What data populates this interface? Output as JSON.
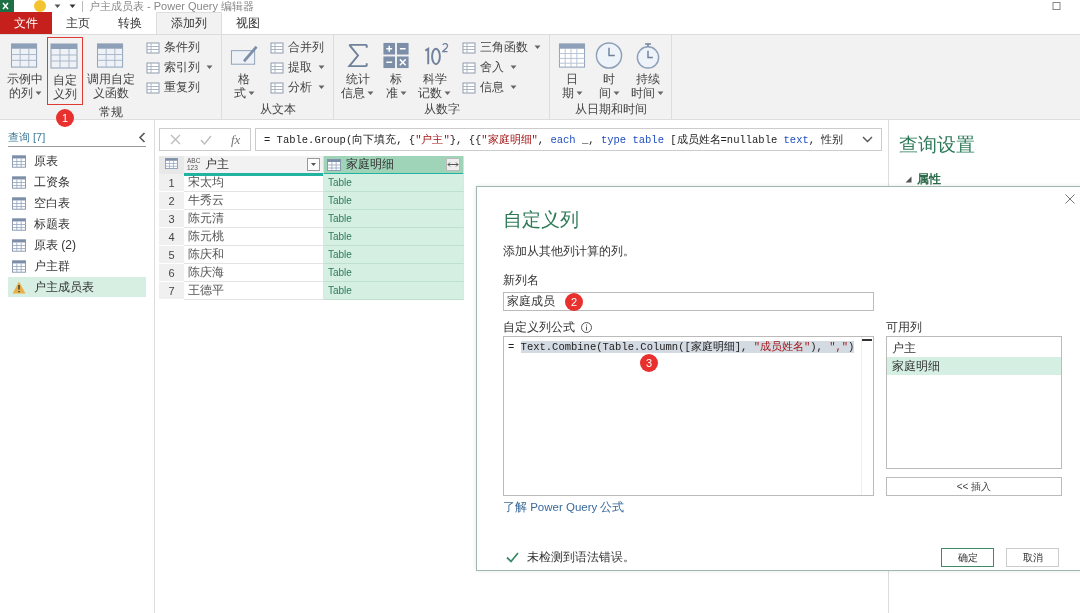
{
  "window": {
    "title": "户主成员表 - Power Query 编辑器"
  },
  "menu_tabs": [
    {
      "label": "文件",
      "kind": "file",
      "selected": false
    },
    {
      "label": "主页",
      "kind": "tab",
      "selected": false
    },
    {
      "label": "转换",
      "kind": "tab",
      "selected": false
    },
    {
      "label": "添加列",
      "kind": "tab",
      "selected": true
    },
    {
      "label": "视图",
      "kind": "tab",
      "selected": false
    }
  ],
  "ribbon": {
    "groups": [
      {
        "name": "常规",
        "items": [
          {
            "kind": "large",
            "label_lines": [
              "示例中",
              "的列"
            ],
            "dropdown": true,
            "highlighted": false
          },
          {
            "kind": "large",
            "label_lines": [
              "自定",
              "义列"
            ],
            "dropdown": false,
            "highlighted": true,
            "badge": "1"
          },
          {
            "kind": "large",
            "label_lines": [
              "调用自定",
              "义函数"
            ],
            "dropdown": false,
            "highlighted": false
          },
          {
            "kind": "small",
            "label": "条件列",
            "dropdown": false
          },
          {
            "kind": "small",
            "label": "索引列",
            "dropdown": true
          },
          {
            "kind": "small",
            "label": "重复列",
            "dropdown": false
          }
        ]
      },
      {
        "name": "从文本",
        "items": [
          {
            "kind": "large",
            "label_lines": [
              "格",
              "式"
            ],
            "dropdown": true,
            "highlighted": false
          },
          {
            "kind": "small",
            "label": "合并列",
            "dropdown": false
          },
          {
            "kind": "small",
            "label": "提取",
            "dropdown": true
          },
          {
            "kind": "small",
            "label": "分析",
            "dropdown": true
          }
        ]
      },
      {
        "name": "从数字",
        "items": [
          {
            "kind": "large",
            "label_lines": [
              "统计",
              "信息"
            ],
            "dropdown": true,
            "highlighted": false
          },
          {
            "kind": "large",
            "label_lines": [
              "标",
              "准"
            ],
            "dropdown": true,
            "highlighted": false
          },
          {
            "kind": "large",
            "label_lines": [
              "科学",
              "记数"
            ],
            "dropdown": true,
            "highlighted": false
          },
          {
            "kind": "small",
            "label": "三角函数",
            "dropdown": true
          },
          {
            "kind": "small",
            "label": "舍入",
            "dropdown": true
          },
          {
            "kind": "small",
            "label": "信息",
            "dropdown": true
          }
        ]
      },
      {
        "name": "从日期和时间",
        "items": [
          {
            "kind": "large",
            "label_lines": [
              "日",
              "期"
            ],
            "dropdown": true,
            "highlighted": false
          },
          {
            "kind": "large",
            "label_lines": [
              "时",
              "间"
            ],
            "dropdown": true,
            "highlighted": false
          },
          {
            "kind": "large",
            "label_lines": [
              "持续",
              "时间"
            ],
            "dropdown": true,
            "highlighted": false
          }
        ]
      }
    ]
  },
  "queries": {
    "header": "查询 [7]",
    "items": [
      {
        "label": "原表",
        "kind": "table",
        "selected": false
      },
      {
        "label": "工资条",
        "kind": "table",
        "selected": false
      },
      {
        "label": "空白表",
        "kind": "table",
        "selected": false
      },
      {
        "label": "标题表",
        "kind": "table",
        "selected": false
      },
      {
        "label": "原表 (2)",
        "kind": "table",
        "selected": false
      },
      {
        "label": "户主群",
        "kind": "table",
        "selected": false
      },
      {
        "label": "户主成员表",
        "kind": "warning",
        "selected": true
      }
    ]
  },
  "formula_bar": {
    "fx_label": "fx",
    "tokens": [
      {
        "text": "= Table.Group(向下填充, {",
        "kind": "plain"
      },
      {
        "text": "\"户主\"",
        "kind": "string"
      },
      {
        "text": "}, {{",
        "kind": "plain"
      },
      {
        "text": "\"家庭明细\"",
        "kind": "string"
      },
      {
        "text": ", ",
        "kind": "plain"
      },
      {
        "text": "each",
        "kind": "keyword"
      },
      {
        "text": " _, ",
        "kind": "plain"
      },
      {
        "text": "type",
        "kind": "keyword"
      },
      {
        "text": " table",
        "kind": "keyword"
      },
      {
        "text": " [成员姓名=nullable ",
        "kind": "plain"
      },
      {
        "text": "text",
        "kind": "keyword"
      },
      {
        "text": ", 性别",
        "kind": "plain"
      }
    ]
  },
  "table": {
    "columns": [
      {
        "name": "户主",
        "kind": "any",
        "type_lines": [
          "ABC",
          "123"
        ],
        "selected": false
      },
      {
        "name": "家庭明细",
        "kind": "table",
        "selected": true
      }
    ],
    "rows": [
      {
        "index": "1",
        "cells": [
          "宋太均",
          "Table"
        ]
      },
      {
        "index": "2",
        "cells": [
          "牛秀云",
          "Table"
        ]
      },
      {
        "index": "3",
        "cells": [
          "陈元清",
          "Table"
        ]
      },
      {
        "index": "4",
        "cells": [
          "陈元桃",
          "Table"
        ]
      },
      {
        "index": "5",
        "cells": [
          "陈庆和",
          "Table"
        ]
      },
      {
        "index": "6",
        "cells": [
          "陈庆海",
          "Table"
        ]
      },
      {
        "index": "7",
        "cells": [
          "王德平",
          "Table"
        ]
      }
    ]
  },
  "query_settings": {
    "title": "查询设置",
    "section": "属性",
    "expanded": true
  },
  "dialog": {
    "title": "自定义列",
    "description": "添加从其他列计算的列。",
    "name_label": "新列名",
    "name_value": "家庭成员",
    "name_badge": "2",
    "formula_label": "自定义列公式",
    "formula_badge": "3",
    "formula_tokens": [
      {
        "text": "= ",
        "kind": "plain",
        "selected": false
      },
      {
        "text": "Text.Combine(Table.Column([",
        "kind": "plain",
        "selected": true
      },
      {
        "text": "家庭明细",
        "kind": "plain",
        "selected": true
      },
      {
        "text": "], ",
        "kind": "plain",
        "selected": true
      },
      {
        "text": "\"成员姓名\"",
        "kind": "string",
        "selected": true
      },
      {
        "text": "), ",
        "kind": "plain",
        "selected": true
      },
      {
        "text": "\",\"",
        "kind": "string",
        "selected": true
      },
      {
        "text": ")",
        "kind": "plain",
        "selected": true
      }
    ],
    "columns_label": "可用列",
    "columns": [
      {
        "label": "户主",
        "selected": false
      },
      {
        "label": "家庭明细",
        "selected": true
      }
    ],
    "insert_button": "<< 插入",
    "help_link": "了解 Power Query 公式",
    "status": "未检测到语法错误。",
    "status_ok": true,
    "ok_button": "确定",
    "cancel_button": "取消"
  }
}
